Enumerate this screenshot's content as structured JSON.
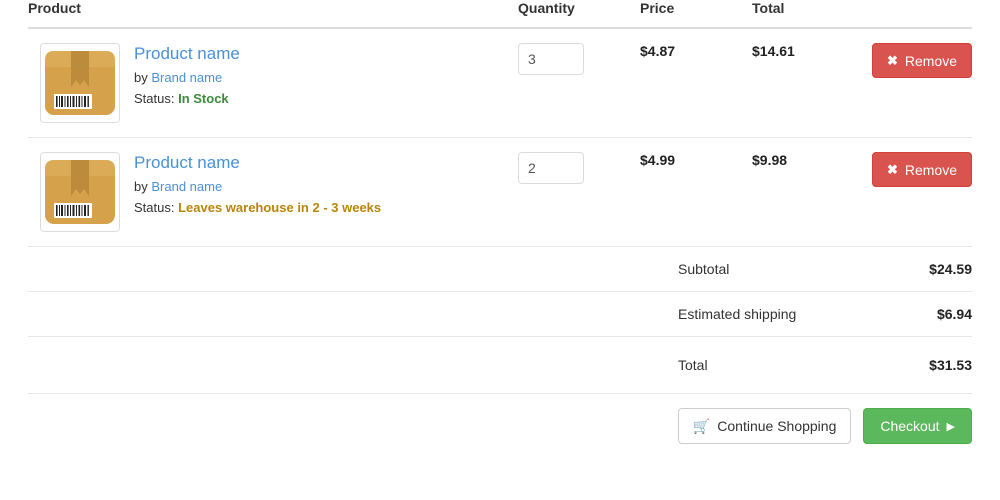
{
  "table": {
    "headers": {
      "product": "Product",
      "quantity": "Quantity",
      "price": "Price",
      "total": "Total",
      "action": ""
    }
  },
  "items": [
    {
      "thumbnail_icon": "package-box-icon",
      "name": "Product name",
      "by_prefix": "by",
      "brand": "Brand name",
      "status_label": "Status:",
      "status_value": "In Stock",
      "status_kind": "instock",
      "quantity": "3",
      "quantity_placeholder": "",
      "price": "$4.87",
      "line_total": "$14.61",
      "remove_label": "Remove",
      "remove_icon": "times-icon"
    },
    {
      "thumbnail_icon": "package-box-icon",
      "name": "Product name",
      "by_prefix": "by",
      "brand": "Brand name",
      "status_label": "Status:",
      "status_value": "Leaves warehouse in 2 - 3 weeks",
      "status_kind": "delayed",
      "quantity": "2",
      "quantity_placeholder": "",
      "price": "$4.99",
      "line_total": "$9.98",
      "remove_label": "Remove",
      "remove_icon": "times-icon"
    }
  ],
  "summary": {
    "subtotal_label": "Subtotal",
    "subtotal_value": "$24.59",
    "shipping_label": "Estimated shipping",
    "shipping_value": "$6.94",
    "total_label": "Total",
    "total_value": "$31.53"
  },
  "actions": {
    "continue_label": "Continue Shopping",
    "continue_icon": "shopping-cart-icon",
    "checkout_label": "Checkout",
    "checkout_icon": "play-arrow-icon"
  },
  "colors": {
    "link": "#4a90d9",
    "danger": "#d9534f",
    "success": "#5cb85c",
    "in_stock": "#3d8b3d",
    "delayed": "#b8860b",
    "box_fill": "#d6a14b",
    "box_tape": "#bd8b3c",
    "border": "#e6e6e6"
  }
}
